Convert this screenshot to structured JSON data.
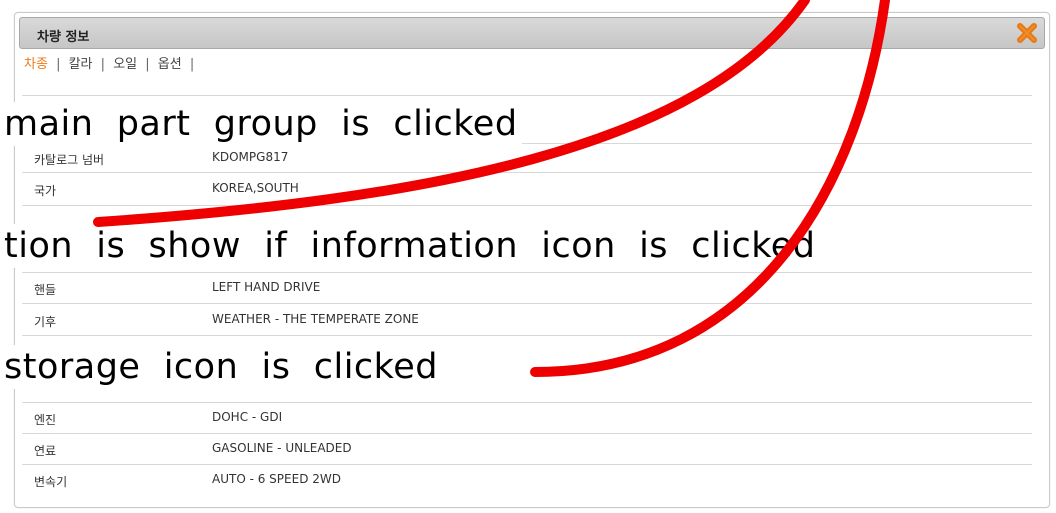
{
  "dialog": {
    "title": "차량 정보",
    "close_icon": "close-x-icon",
    "accent_color": "#f07b1a"
  },
  "tabs": [
    {
      "label": "차종",
      "active": true
    },
    {
      "label": "칼라",
      "active": false
    },
    {
      "label": "오일",
      "active": false
    },
    {
      "label": "옵션",
      "active": false
    }
  ],
  "tab_separator": "|",
  "rows": [
    {
      "label": "카탈로그 넘버",
      "value": "KDOMPG817"
    },
    {
      "label": "국가",
      "value": "KOREA,SOUTH"
    },
    {
      "label": "핸들",
      "value": "LEFT HAND DRIVE"
    },
    {
      "label": "기후",
      "value": "WEATHER - THE TEMPERATE ZONE"
    },
    {
      "label": "엔진",
      "value": "DOHC - GDI"
    },
    {
      "label": "연료",
      "value": "GASOLINE - UNLEADED"
    },
    {
      "label": "변속기",
      "value": "AUTO - 6 SPEED 2WD"
    }
  ],
  "annotations": {
    "line1": "main  part  group  is  clicked",
    "line2": "tion  is  show  if  information  icon  is  clicked",
    "line3": "storage  icon  is  clicked",
    "stroke_color": "#ee0000"
  }
}
